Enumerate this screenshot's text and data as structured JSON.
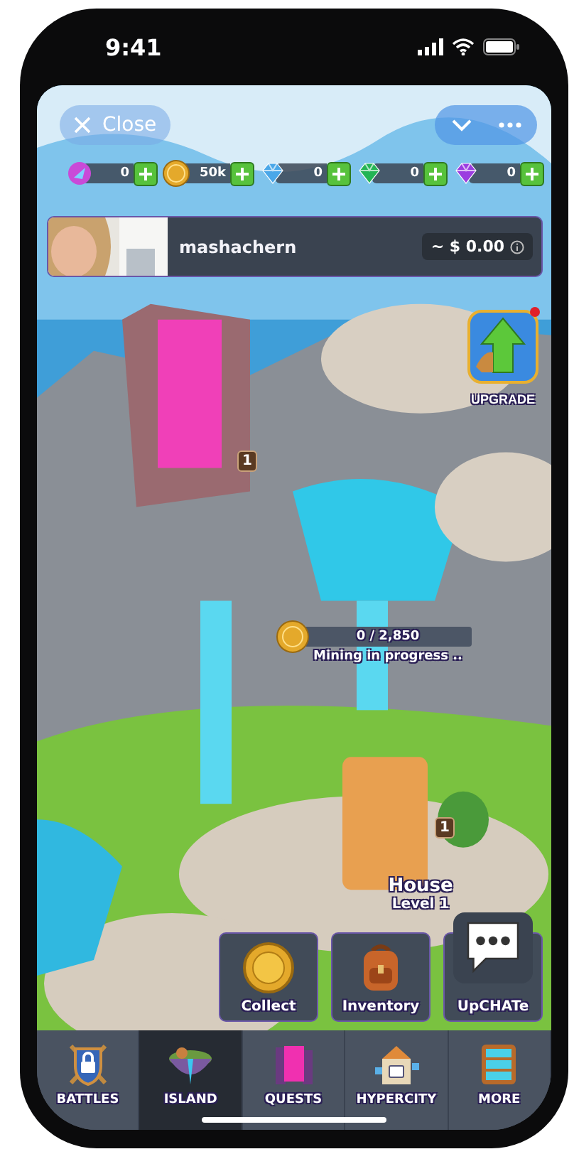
{
  "status_bar": {
    "time": "9:41"
  },
  "top_bar": {
    "close_label": "Close"
  },
  "currencies": [
    {
      "kind": "energy",
      "amount": "0"
    },
    {
      "kind": "coin",
      "amount": "50k"
    },
    {
      "kind": "diamond",
      "amount": "0"
    },
    {
      "kind": "emerald",
      "amount": "0"
    },
    {
      "kind": "amethyst",
      "amount": "0"
    }
  ],
  "player": {
    "name": "mashachern",
    "balance": "~ $ 0.00"
  },
  "upgrade": {
    "label": "UPGRADE",
    "notification": true
  },
  "portal_badge": "1",
  "mining": {
    "progress": "0 / 2,850",
    "status": "Mining in progress .."
  },
  "house_badge": "1",
  "building": {
    "name": "House",
    "level": "Level 1"
  },
  "actions": [
    {
      "kind": "coin",
      "label": "Collect"
    },
    {
      "kind": "backpack",
      "label": "Inventory"
    },
    {
      "kind": "chat",
      "label": "UpCHATe"
    }
  ],
  "nav": [
    {
      "kind": "shield",
      "label": "BATTLES",
      "selected": false
    },
    {
      "kind": "island",
      "label": "ISLAND",
      "selected": true
    },
    {
      "kind": "portal",
      "label": "QUESTS",
      "selected": false
    },
    {
      "kind": "city",
      "label": "HYPERCITY",
      "selected": false
    },
    {
      "kind": "menu",
      "label": "MORE",
      "selected": false
    }
  ]
}
